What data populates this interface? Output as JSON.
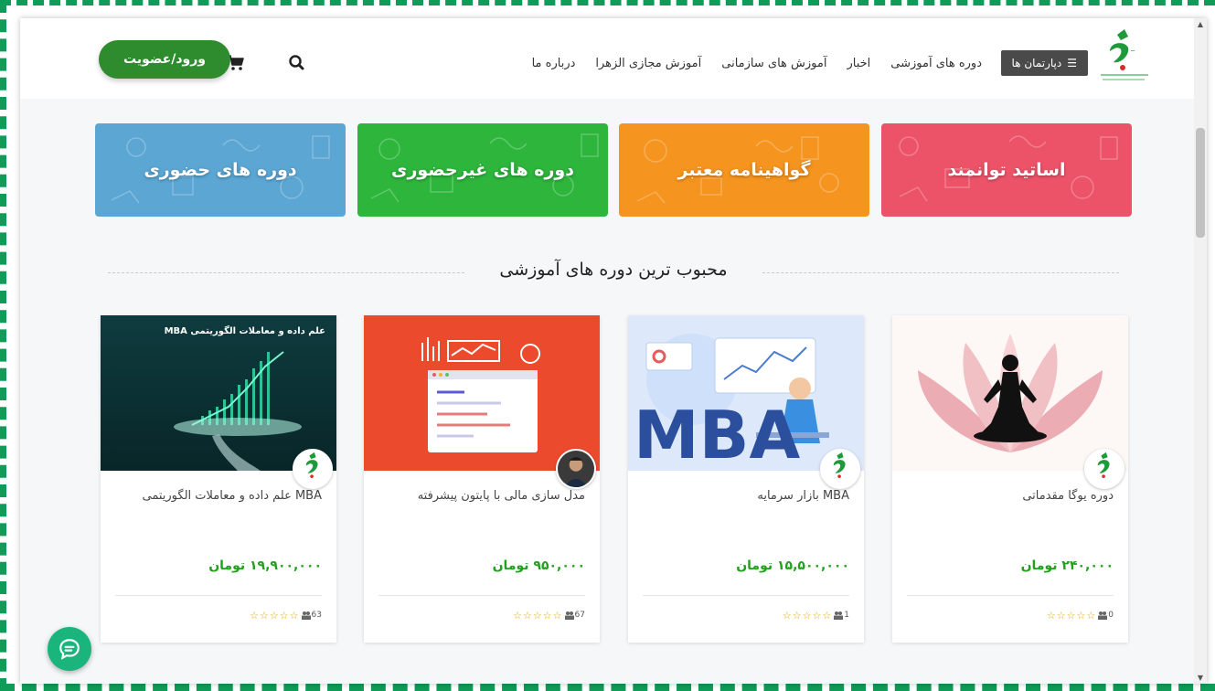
{
  "header": {
    "departments_label": "دپارتمان ها",
    "nav": [
      "دوره های آموزشی",
      "اخبار",
      "آموزش های سازمانی",
      "آموزش مجازی الزهرا",
      "درباره ما"
    ],
    "login_label": "ورود/عضویت",
    "logo_icon": "alzahra-logo-icon",
    "search_icon": "search-icon",
    "cart_icon": "cart-icon"
  },
  "banners": [
    {
      "label": "اساتید توانمند",
      "color": "#ec5369"
    },
    {
      "label": "گواهینامه معتبر",
      "color": "#f5941f"
    },
    {
      "label": "دوره های غیرحضوری",
      "color": "#2db53c"
    },
    {
      "label": "دوره های حضوری",
      "color": "#5ba6d3"
    }
  ],
  "section": {
    "title": "محبوب ترین دوره های آموزشی"
  },
  "courses": [
    {
      "title": "دوره یوگا مقدماتی",
      "price": "۲۴۰,۰۰۰ تومان",
      "rating": 0,
      "students": "0",
      "image": "yoga-meditation-image"
    },
    {
      "title": "MBA بازار سرمایه",
      "price": "۱۵,۵۰۰,۰۰۰ تومان",
      "rating": 0,
      "students": "1",
      "image": "mba-image"
    },
    {
      "title": "مدل سازی مالی با پایتون پیشرفته",
      "price": "۹۵۰,۰۰۰ تومان",
      "rating": 0,
      "students": "67",
      "image": "financial-modeling-image"
    },
    {
      "title": "MBA علم داده و معاملات الگوریتمی",
      "price": "۱۹,۹۰۰,۰۰۰ تومان",
      "rating": 0,
      "students": "63",
      "image": "data-science-trading-image",
      "image_caption": "MBA علم داده و معاملات الگوریتمی"
    }
  ],
  "mba_image_text": "MBA",
  "colors": {
    "accent_green": "#2e8b2e",
    "price_green": "#22a01e",
    "frame_green": "#0f9b58",
    "chat_green": "#19b57d"
  },
  "chat_icon": "chat-icon"
}
